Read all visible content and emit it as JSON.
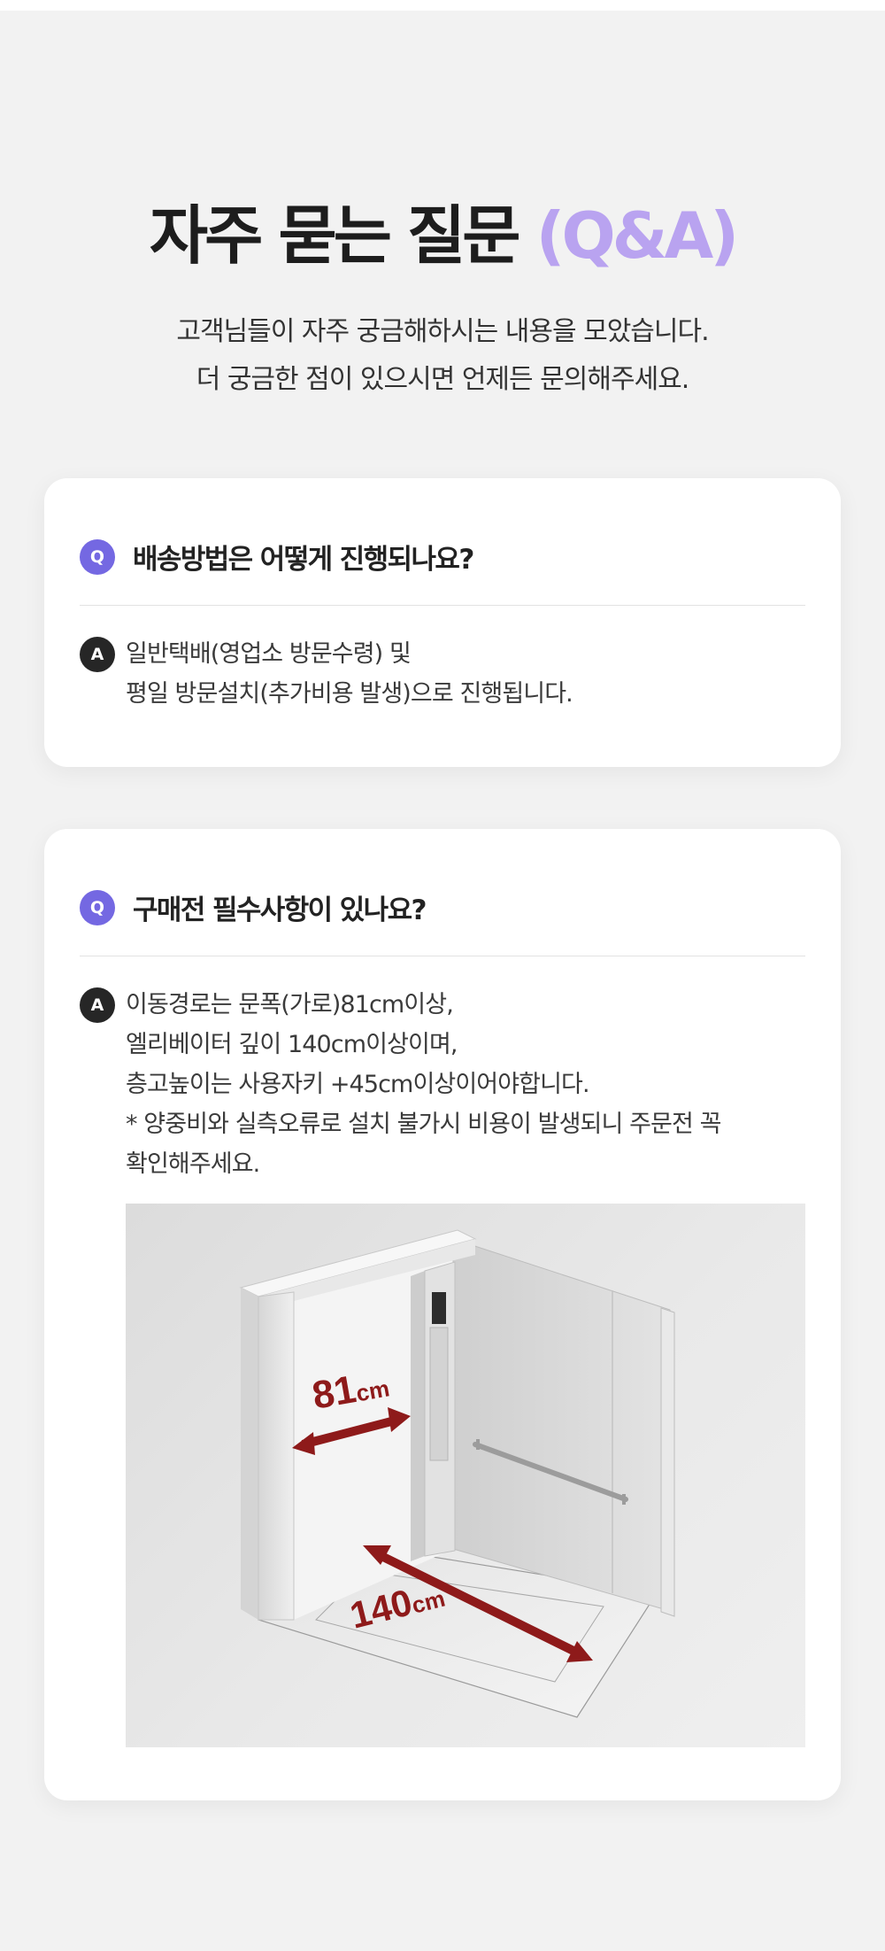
{
  "header": {
    "title_main": "자주 묻는 질문",
    "title_accent": "(Q&A)",
    "subtitle_lines": [
      "고객님들이 자주 궁금해하시는 내용을 모았습니다.",
      "더 궁금한 점이 있으시면 언제든 문의해주세요."
    ]
  },
  "faq": [
    {
      "q_badge": "Q",
      "question": "배송방법은 어떻게 진행되나요?",
      "a_badge": "A",
      "answer_lines": [
        "일반택배(영업소 방문수령) 및",
        "평일 방문설치(추가비용 발생)으로 진행됩니다."
      ]
    },
    {
      "q_badge": "Q",
      "question": "구매전 필수사항이 있나요?",
      "a_badge": "A",
      "answer_lines": [
        "이동경로는 문폭(가로)81cm이상,",
        "엘리베이터 깊이 140cm이상이며,",
        "층고높이는 사용자키 +45cm이상이어야합니다.",
        "* 양중비와 실측오류로 설치 불가시 비용이 발생되니 주문전 꼭",
        "확인해주세요."
      ],
      "figure": {
        "width_label_num": "81",
        "width_label_unit": "cm",
        "depth_label_num": "140",
        "depth_label_unit": "cm",
        "arrow_color": "#8e1a1a"
      }
    }
  ]
}
